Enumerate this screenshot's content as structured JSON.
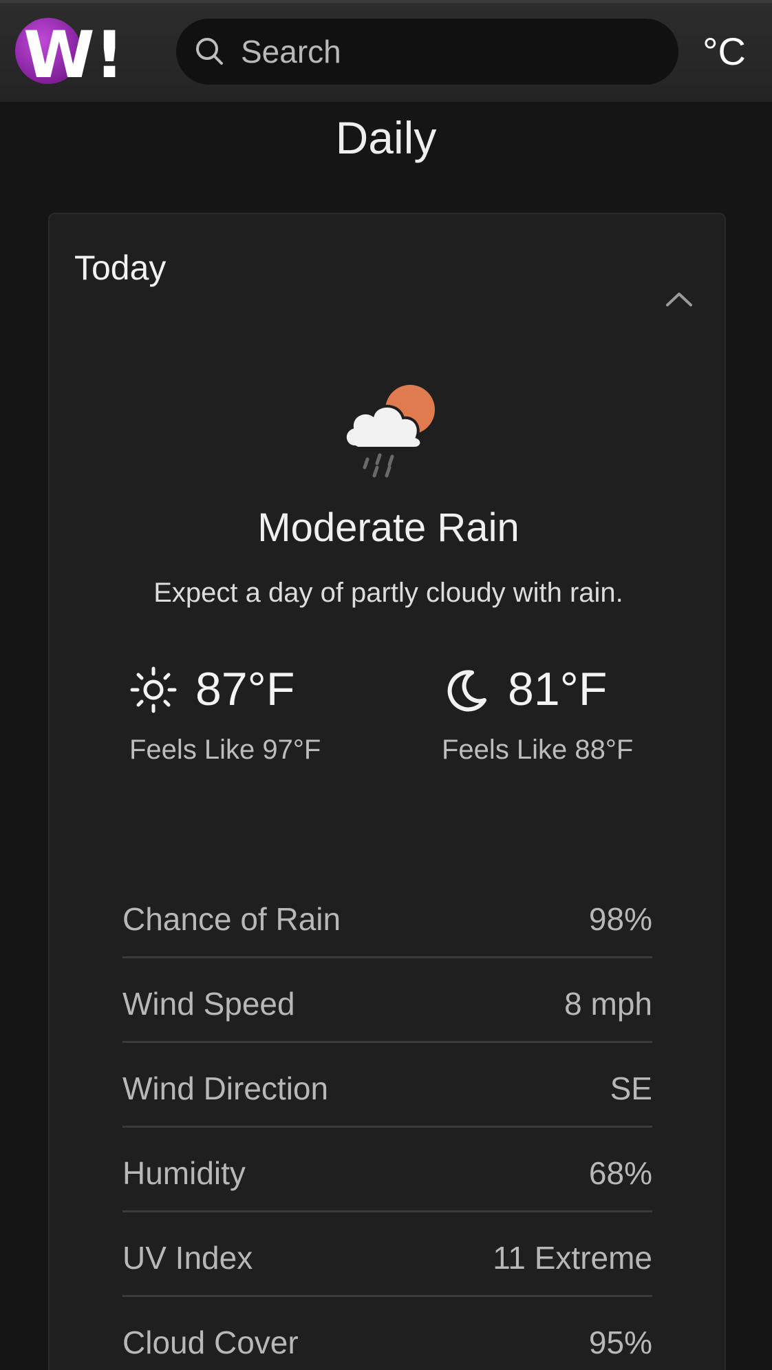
{
  "header": {
    "logo_text": "W!",
    "search_placeholder": "Search",
    "unit_toggle": "°C"
  },
  "page_title": "Daily",
  "card": {
    "day_label": "Today",
    "condition": "Moderate Rain",
    "summary": "Expect a day of partly cloudy with rain.",
    "day_temp": "87°F",
    "day_feels_like": "Feels Like 97°F",
    "night_temp": "81°F",
    "night_feels_like": "Feels Like 88°F",
    "details": [
      {
        "label": "Chance of Rain",
        "value": "98%"
      },
      {
        "label": "Wind Speed",
        "value": "8 mph"
      },
      {
        "label": "Wind Direction",
        "value": "SE"
      },
      {
        "label": "Humidity",
        "value": "68%"
      },
      {
        "label": "UV Index",
        "value": "11 Extreme"
      },
      {
        "label": "Cloud Cover",
        "value": "95%"
      }
    ]
  },
  "icons": {
    "logo": "w-exclaim-logo",
    "search": "search-icon",
    "collapse": "chevron-up-icon",
    "weather": "partly-cloudy-rain-icon",
    "day": "sun-icon",
    "night": "moon-icon"
  },
  "colors": {
    "background": "#151515",
    "header": "#242424",
    "card": "#1f1f1f",
    "logo_purple": "#9b2bb5",
    "sun_orange": "#e07a4f"
  }
}
